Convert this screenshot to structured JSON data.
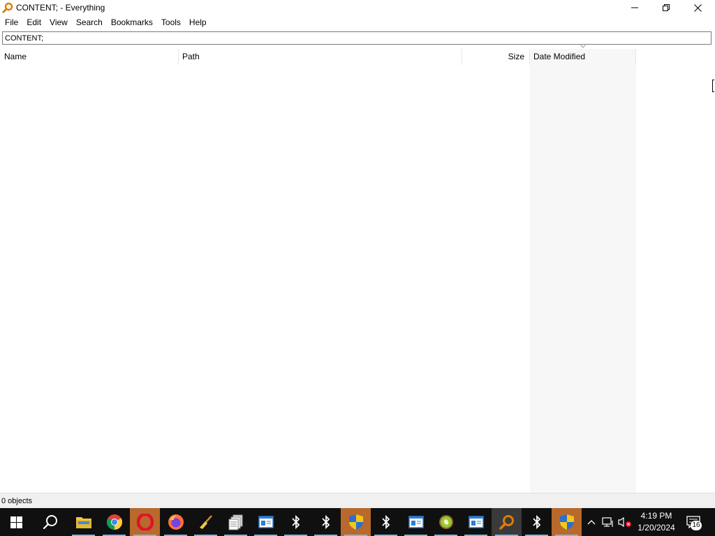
{
  "window": {
    "title": "CONTENT; - Everything"
  },
  "menu": {
    "items": [
      "File",
      "Edit",
      "View",
      "Search",
      "Bookmarks",
      "Tools",
      "Help"
    ]
  },
  "search": {
    "value": "CONTENT;"
  },
  "columns": {
    "name": "Name",
    "path": "Path",
    "size": "Size",
    "date_modified": "Date Modified",
    "sort_column": "Date Modified",
    "sort_direction": "descending"
  },
  "results": [],
  "status": {
    "text": "0 objects"
  },
  "taskbar": {
    "apps": [
      {
        "name": "start",
        "icon": "windows-logo-icon"
      },
      {
        "name": "search",
        "icon": "search-icon"
      },
      {
        "name": "file-explorer",
        "icon": "folder-icon"
      },
      {
        "name": "chrome",
        "icon": "chrome-icon"
      },
      {
        "name": "opera",
        "icon": "opera-icon"
      },
      {
        "name": "firefox",
        "icon": "firefox-icon"
      },
      {
        "name": "cleaner",
        "icon": "broom-icon"
      },
      {
        "name": "files",
        "icon": "documents-icon"
      },
      {
        "name": "window-app-1",
        "icon": "window-icon"
      },
      {
        "name": "bluetooth-1",
        "icon": "bluetooth-icon"
      },
      {
        "name": "bluetooth-2",
        "icon": "bluetooth-icon"
      },
      {
        "name": "uac-1",
        "icon": "shield-icon"
      },
      {
        "name": "bluetooth-3",
        "icon": "bluetooth-icon"
      },
      {
        "name": "window-app-2",
        "icon": "window-icon"
      },
      {
        "name": "kiwi",
        "icon": "kiwi-icon"
      },
      {
        "name": "window-app-3",
        "icon": "window-icon"
      },
      {
        "name": "everything",
        "icon": "magnifier-icon"
      },
      {
        "name": "bluetooth-4",
        "icon": "bluetooth-icon"
      },
      {
        "name": "uac-2",
        "icon": "shield-icon"
      }
    ],
    "clock": {
      "time": "4:19 PM",
      "date": "1/20/2024"
    },
    "notification_count": "16"
  },
  "colors": {
    "taskbar_bg": "#101010",
    "accent_orange": "#b9692c",
    "running_indicator": "#76b9ed",
    "date_column_bg": "#f7f7f7"
  }
}
